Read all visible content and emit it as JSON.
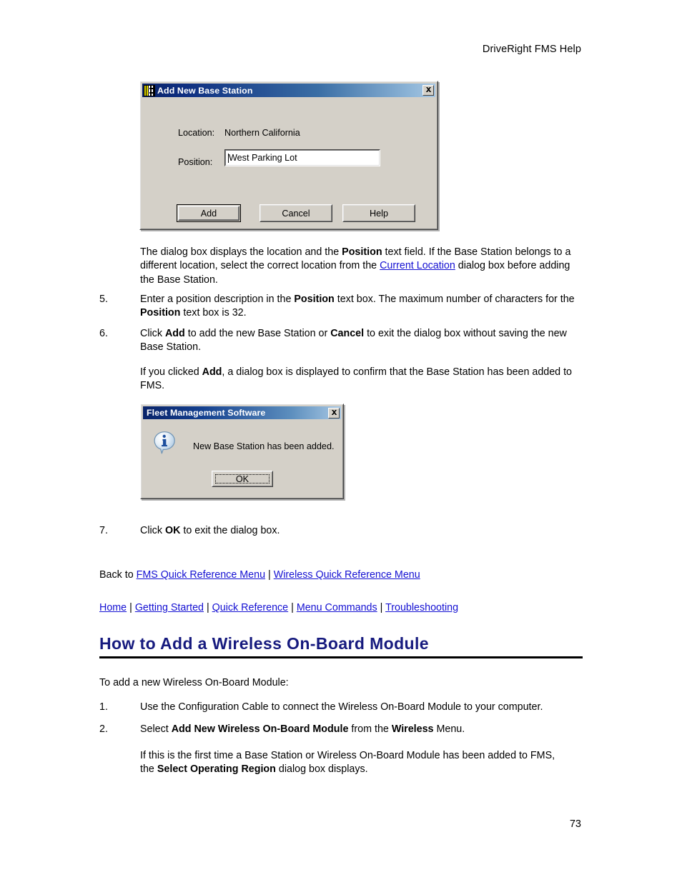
{
  "document": {
    "header": "DriveRight FMS Help",
    "page_number": "73"
  },
  "dialog_add_base_station": {
    "title": "Add New Base Station",
    "icon": "base-station-icon",
    "close_label": "✕",
    "location_label": "Location:",
    "location_value": "Northern California",
    "position_label": "Position:",
    "position_value": "West Parking Lot",
    "buttons": {
      "add": "Add",
      "cancel": "Cancel",
      "help": "Help"
    }
  },
  "paragraph_after_dialog": {
    "part1": "The dialog box displays the location and the ",
    "bold1": "Position",
    "part2": " text field. If the Base Station belongs to a different location, select the correct location from the ",
    "link1": "Current Location",
    "part3": " dialog box before adding the Base Station."
  },
  "steps": [
    {
      "number": "5.",
      "part1": "Enter a position description in the ",
      "bold1": "Position",
      "part2": " text box. The maximum number of characters for the ",
      "bold2": "Position",
      "part3": " text box is 32."
    },
    {
      "number": "6.",
      "part1": "Click ",
      "bold1": "Add",
      "part2": " to add the new Base Station or ",
      "bold2": "Cancel",
      "part3": " to exit the dialog box without saving the new Base Station."
    },
    {
      "number": "7.",
      "part1": "Click ",
      "bold1": "OK",
      "part2": " to exit the dialog box."
    }
  ],
  "paragraph_confirm": {
    "part1": "If you clicked ",
    "bold1": "Add",
    "part2": ", a dialog box is displayed to confirm that the Base Station has been added to FMS."
  },
  "dialog_fms_confirm": {
    "title": "Fleet Management Software",
    "icon": "information-icon",
    "close_label": "✕",
    "message": "New Base Station has been added.",
    "buttons": {
      "ok": "OK"
    }
  },
  "back_to": {
    "prefix": "Back to ",
    "links": [
      "FMS Quick Reference Menu",
      "Wireless Quick Reference Menu"
    ],
    "separator": " | "
  },
  "footer_nav": {
    "links": [
      "Home",
      "Getting Started",
      "Quick Reference",
      "Menu Commands",
      "Troubleshooting"
    ],
    "separator": " | "
  },
  "section": {
    "heading": "How to Add a Wireless On-Board Module",
    "intro": "To add a new Wireless On-Board Module:",
    "steps": [
      {
        "number": "1.",
        "part1": "Use the Configuration Cable to connect the Wireless On-Board Module to your computer."
      },
      {
        "number": "2.",
        "part1": "Select ",
        "bold1": "Add New Wireless On-Board Module",
        "part2": " from the ",
        "bold2": "Wireless",
        "part3": " Menu."
      }
    ],
    "note": {
      "part1": "If this is the first time a Base Station or Wireless On-Board Module has been added to FMS, the ",
      "bold1": "Select Operating Region",
      "part2": " dialog box displays."
    }
  },
  "colors": {
    "link": "#1410d2",
    "heading": "#161a7e",
    "dialog_face": "#d4d0c8",
    "titlebar_start": "#0a246a",
    "titlebar_end": "#a6c6e2"
  }
}
